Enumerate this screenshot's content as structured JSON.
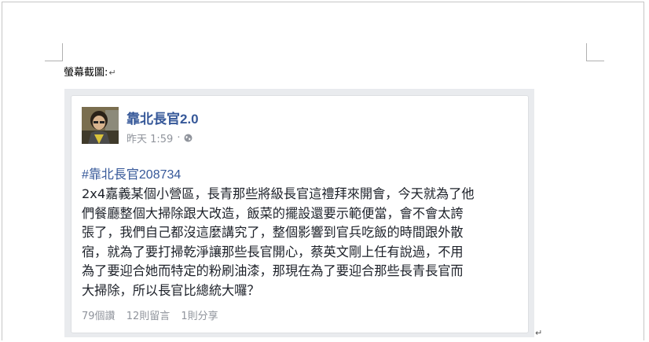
{
  "document": {
    "heading": "螢幕截圖:",
    "paragraph_mark": "↵"
  },
  "post": {
    "page_name": "靠北長官2.0",
    "timestamp": "昨天 1:59",
    "separator": "·",
    "privacy_icon": "globe-icon",
    "hashtag": "#靠北長官208734",
    "body_lines": [
      "2x4嘉義某個小營區，長青那些將級長官這禮拜來開會，今天就為了他",
      "們餐廳整個大掃除跟大改造，飯菜的擺設還要示範便當，會不會太誇",
      "張了，我們自己都沒這麼講究了，整個影響到官兵吃飯的時間跟外散",
      "宿，就為了要打掃乾淨讓那些長官開心，蔡英文剛上任有說過，不用",
      "為了要迎合她而特定的粉刷油漆，那現在為了要迎合那些長青長官而",
      "大掃除，所以長官比總統大囉？"
    ],
    "likes": "79個讚",
    "comments": "12則留言",
    "shares": "1則分享"
  },
  "colors": {
    "link_blue": "#365899",
    "meta_gray": "#90949c",
    "text_dark": "#1d2129",
    "screenshot_bg": "#e9ebee"
  }
}
